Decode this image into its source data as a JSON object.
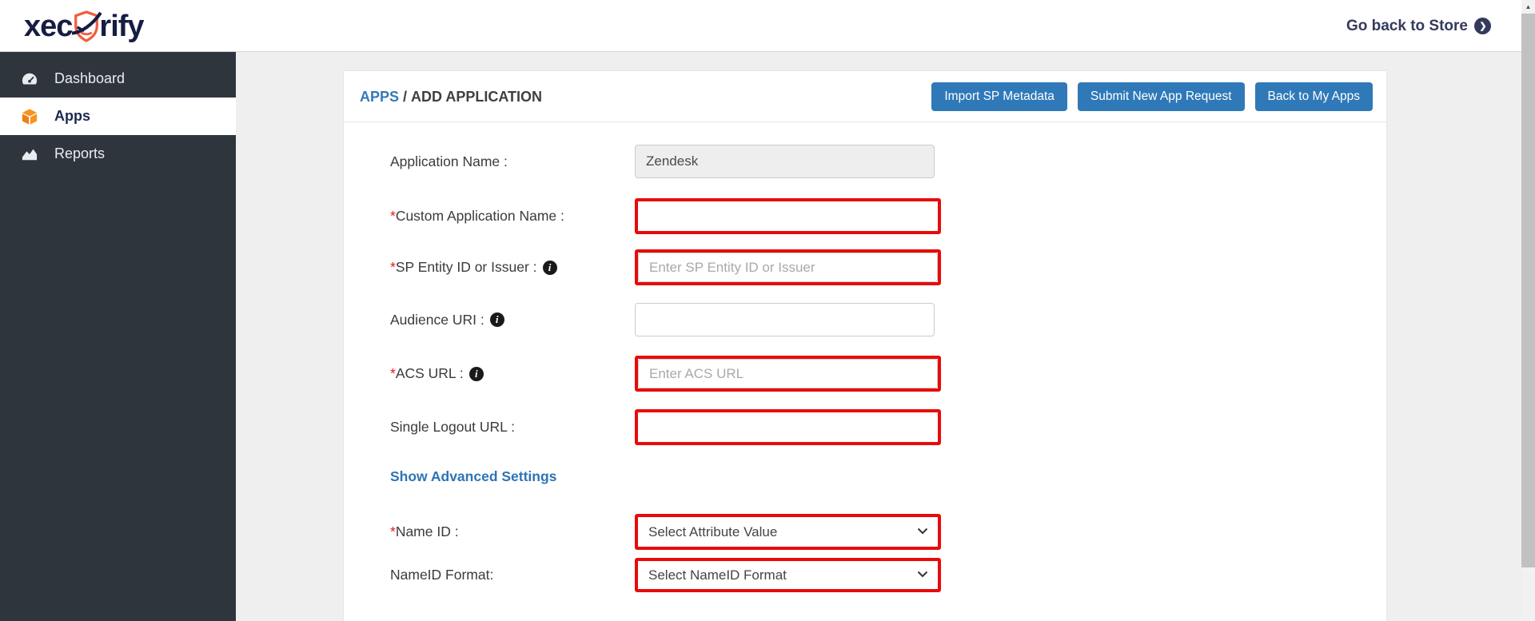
{
  "colors": {
    "accent_blue": "#2f79b8",
    "breadcrumb_blue": "#337ab7",
    "link_blue": "#2e74b5",
    "error_red": "#e80b0b",
    "sidebar_bg": "#2e353d",
    "brand_orange": "#f05e3c",
    "brand_navy": "#171c42"
  },
  "topbar": {
    "logo_text_left": "xec",
    "logo_text_right": "rify",
    "go_back": {
      "label": "Go back to Store",
      "icon_glyph": "❯"
    }
  },
  "sidebar": {
    "items": [
      {
        "label": "Dashboard",
        "icon": "gauge-icon",
        "active": false
      },
      {
        "label": "Apps",
        "icon": "cube-icon",
        "active": true
      },
      {
        "label": "Reports",
        "icon": "area-chart-icon",
        "active": false
      }
    ]
  },
  "breadcrumb": {
    "section": "APPS",
    "separator": " / ",
    "current": "ADD APPLICATION"
  },
  "actions": [
    {
      "label": "Import SP Metadata"
    },
    {
      "label": "Submit New App Request"
    },
    {
      "label": "Back to My Apps"
    }
  ],
  "form": {
    "required_marker": "*",
    "info_glyph": "i",
    "fields": [
      {
        "label": "Application Name :",
        "value": "Zendesk",
        "placeholder": "",
        "required": false,
        "has_info": false,
        "disabled": true,
        "error": false
      },
      {
        "label": "Custom Application Name :",
        "value": "",
        "placeholder": "",
        "required": true,
        "has_info": false,
        "disabled": false,
        "error": true
      },
      {
        "label": "SP Entity ID or Issuer :",
        "value": "",
        "placeholder": "Enter SP Entity ID or Issuer",
        "required": true,
        "has_info": true,
        "disabled": false,
        "error": true
      },
      {
        "label": "Audience URI :",
        "value": "",
        "placeholder": "",
        "required": false,
        "has_info": true,
        "disabled": false,
        "error": false
      },
      {
        "label": "ACS URL :",
        "value": "",
        "placeholder": "Enter ACS URL",
        "required": true,
        "has_info": true,
        "disabled": false,
        "error": true
      },
      {
        "label": "Single Logout URL :",
        "value": "",
        "placeholder": "",
        "required": false,
        "has_info": false,
        "disabled": false,
        "error": true
      }
    ],
    "advanced_settings_link": "Show Advanced Settings",
    "selects": [
      {
        "label": "Name ID :",
        "required": true,
        "value": "Select Attribute Value",
        "error": true
      },
      {
        "label": "NameID Format:",
        "required": false,
        "value": "Select NameID Format",
        "error": true
      }
    ]
  },
  "scrollbar": {
    "up_arrow": "▲"
  }
}
